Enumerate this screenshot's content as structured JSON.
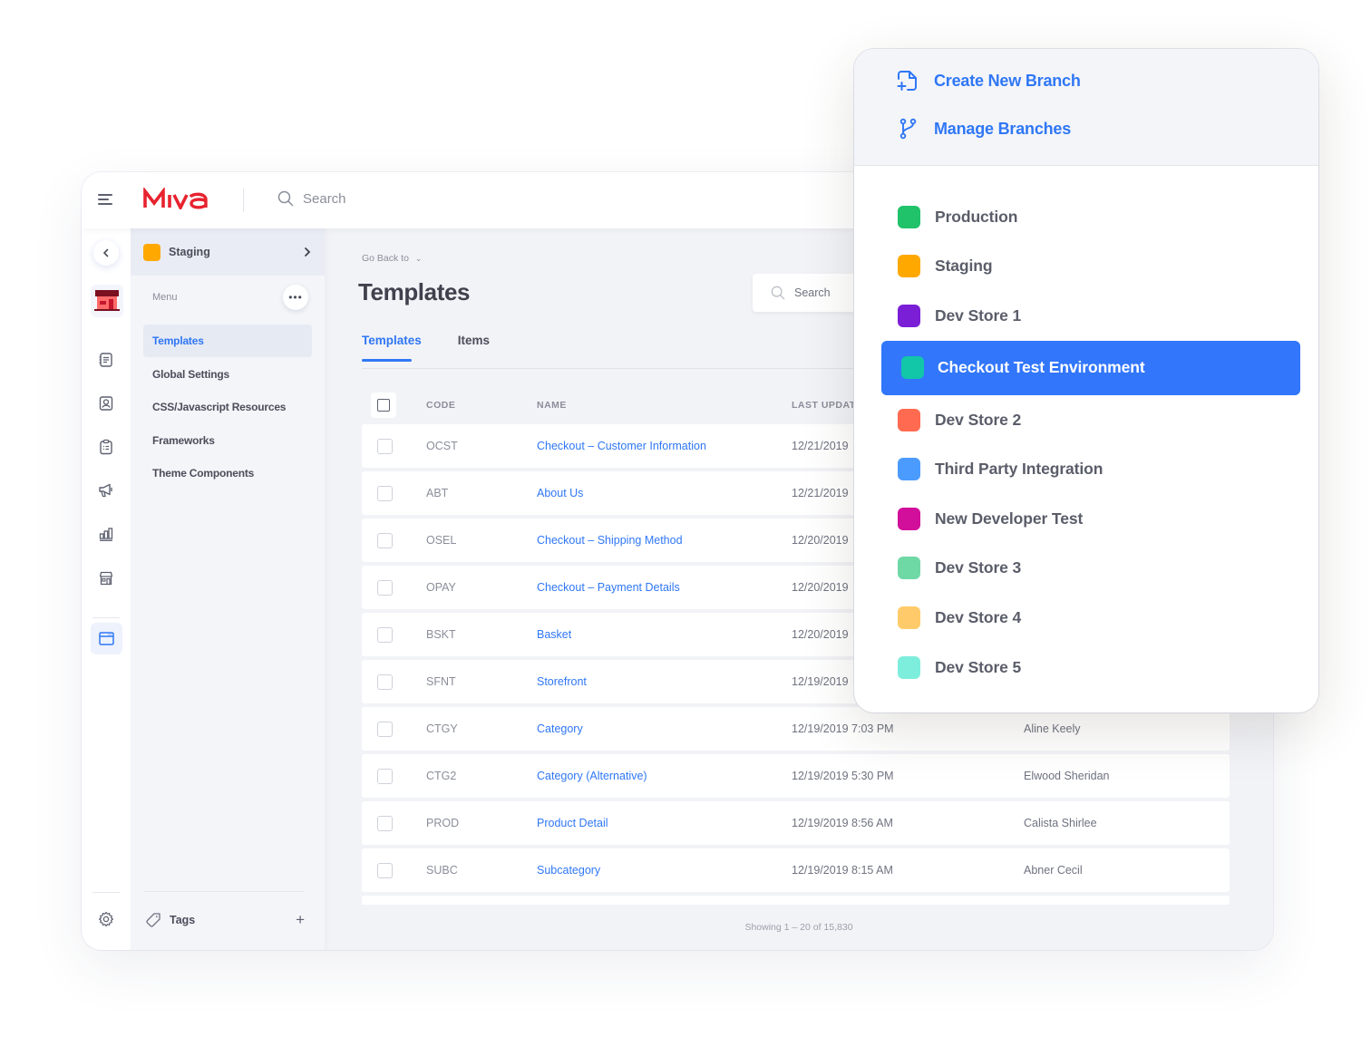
{
  "app": {
    "brand": "MIVA",
    "brand_color": "#e8232f",
    "accent_color": "#2f77f5",
    "top_search_placeholder": "Search"
  },
  "rail": {
    "icons": [
      "orders-icon",
      "customers-icon",
      "clipboard-icon",
      "marketing-icon",
      "reports-icon",
      "storefront-icon",
      "templates-icon",
      "settings-icon"
    ],
    "active": "templates-icon"
  },
  "subnav": {
    "store_name": "Staging",
    "store_color": "#ffa800",
    "menu_label": "Menu",
    "items": [
      {
        "label": "Templates",
        "active": true
      },
      {
        "label": "Global Settings",
        "active": false
      },
      {
        "label": "CSS/Javascript Resources",
        "active": false
      },
      {
        "label": "Frameworks",
        "active": false
      },
      {
        "label": "Theme Components",
        "active": false
      }
    ],
    "tags_label": "Tags"
  },
  "main": {
    "go_back": "Go Back to",
    "title": "Templates",
    "search_placeholder": "Search",
    "tabs": [
      {
        "label": "Templates",
        "active": true
      },
      {
        "label": "Items",
        "active": false
      }
    ],
    "columns": {
      "code": "CODE",
      "name": "NAME",
      "last_updated": "LAST UPDAT"
    },
    "rows": [
      {
        "code": "OCST",
        "name": "Checkout – Customer Information",
        "date": "12/21/2019",
        "user": ""
      },
      {
        "code": "ABT",
        "name": "About Us",
        "date": "12/21/2019",
        "user": ""
      },
      {
        "code": "OSEL",
        "name": "Checkout – Shipping Method",
        "date": "12/20/2019",
        "user": ""
      },
      {
        "code": "OPAY",
        "name": "Checkout – Payment Details",
        "date": "12/20/2019",
        "user": ""
      },
      {
        "code": "BSKT",
        "name": "Basket",
        "date": "12/20/2019",
        "user": ""
      },
      {
        "code": "SFNT",
        "name": "Storefront",
        "date": "12/19/2019",
        "user": ""
      },
      {
        "code": "CTGY",
        "name": "Category",
        "date": "12/19/2019 7:03 PM",
        "user": "Aline Keely"
      },
      {
        "code": "CTG2",
        "name": "Category (Alternative)",
        "date": "12/19/2019 5:30 PM",
        "user": "Elwood Sheridan"
      },
      {
        "code": "PROD",
        "name": "Product Detail",
        "date": "12/19/2019 8:56 AM",
        "user": "Calista Shirlee"
      },
      {
        "code": "SUBC",
        "name": "Subcategory",
        "date": "12/19/2019 8:15 AM",
        "user": "Abner Cecil"
      }
    ],
    "showing": "Showing 1 – 20 of 15,830"
  },
  "popover": {
    "actions": [
      {
        "label": "Create New Branch",
        "icon": "create-branch-icon"
      },
      {
        "label": "Manage Branches",
        "icon": "branch-icon"
      }
    ],
    "branches": [
      {
        "label": "Production",
        "color": "#20c26a",
        "selected": false
      },
      {
        "label": "Staging",
        "color": "#ffa800",
        "selected": false
      },
      {
        "label": "Dev Store 1",
        "color": "#7a1fd6",
        "selected": false
      },
      {
        "label": "Checkout Test Environment",
        "color": "#12c7a8",
        "selected": true
      },
      {
        "label": "Dev Store 2",
        "color": "#ff6a50",
        "selected": false
      },
      {
        "label": "Third Party Integration",
        "color": "#4b9bff",
        "selected": false
      },
      {
        "label": "New Developer Test",
        "color": "#d10f9b",
        "selected": false
      },
      {
        "label": "Dev Store 3",
        "color": "#6fd9a6",
        "selected": false
      },
      {
        "label": "Dev Store 4",
        "color": "#ffcb6a",
        "selected": false
      },
      {
        "label": "Dev Store 5",
        "color": "#7eeedc",
        "selected": false
      }
    ]
  }
}
